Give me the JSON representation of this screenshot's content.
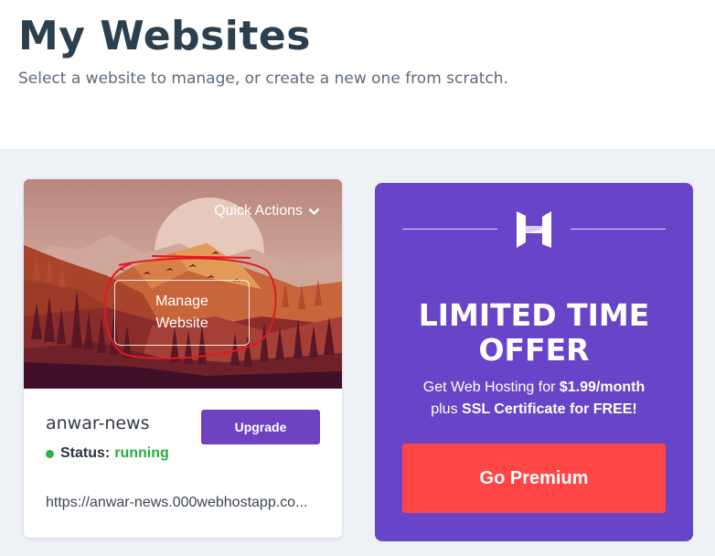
{
  "header": {
    "title": "My Websites",
    "subtitle": "Select a website to manage, or create a new one from scratch."
  },
  "website_card": {
    "quick_actions_label": "Quick Actions",
    "manage_label_line1": "Manage",
    "manage_label_line2": "Website",
    "site_name": "anwar-news",
    "upgrade_label": "Upgrade",
    "status_label": "Status:",
    "status_value": "running",
    "url": "https://anwar-news.000webhostapp.co..."
  },
  "promo": {
    "headline_line1": "LIMITED TIME",
    "headline_line2": "OFFER",
    "desc_prefix": "Get Web Hosting for ",
    "price": "$1.99/month",
    "desc_mid": "plus ",
    "ssl": "SSL Certificate for FREE!",
    "button_label": "Go Premium"
  },
  "colors": {
    "accent_purple": "#6f42c1",
    "promo_background": "#6844c9",
    "premium_button": "#ff4545",
    "status_running": "#27ae3f"
  }
}
